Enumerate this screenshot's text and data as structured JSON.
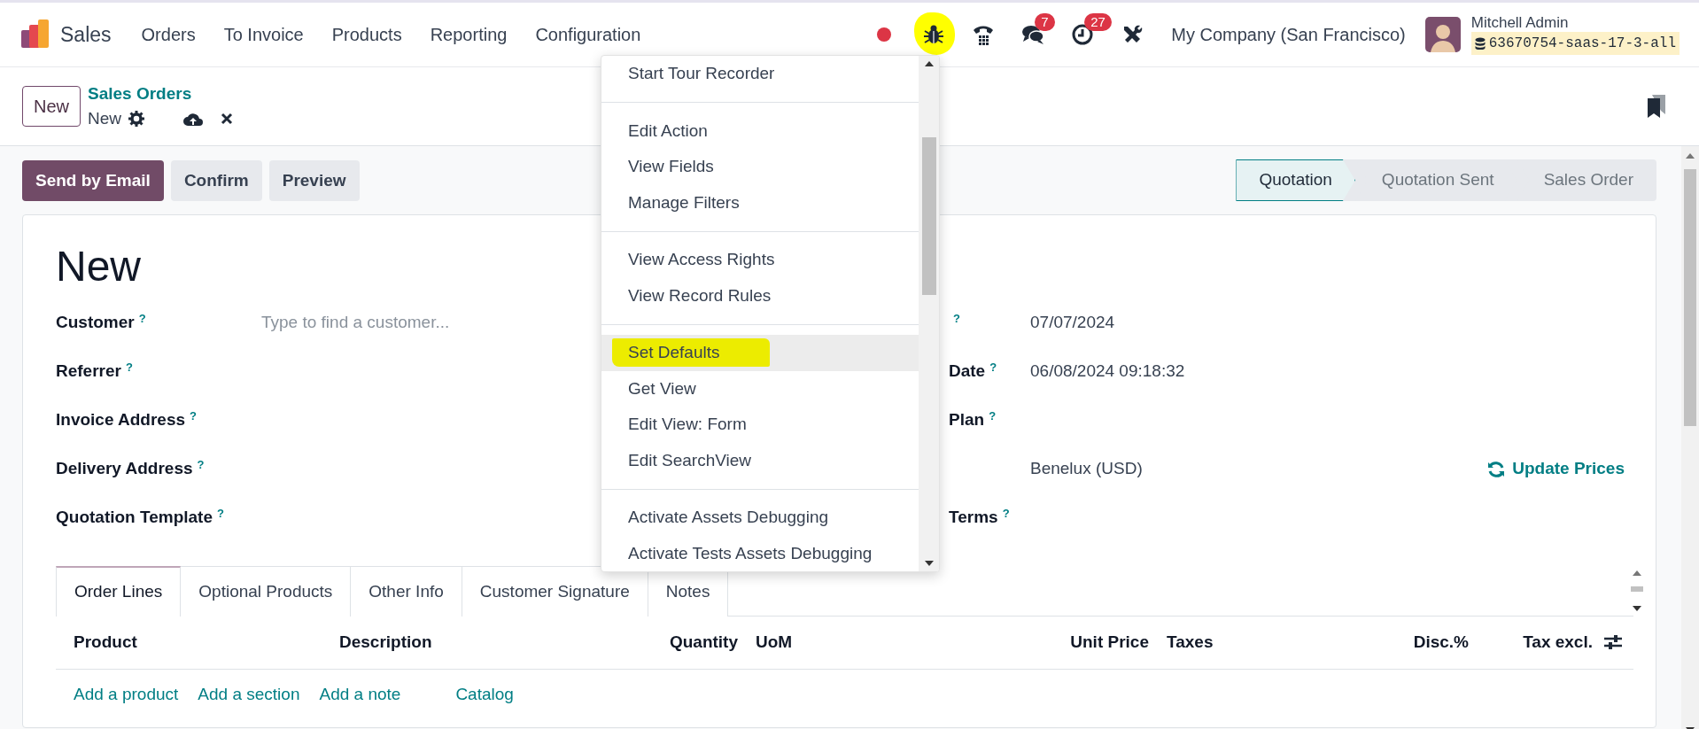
{
  "navbar": {
    "app": "Sales",
    "menus": [
      "Orders",
      "To Invoice",
      "Products",
      "Reporting",
      "Configuration"
    ],
    "systray": [
      {
        "kind": "record",
        "color": "#dc3545"
      },
      {
        "kind": "debug",
        "highlighted": true
      },
      {
        "kind": "phone"
      },
      {
        "kind": "chat",
        "badge": "7"
      },
      {
        "kind": "activity",
        "badge": "27"
      },
      {
        "kind": "tools"
      }
    ],
    "company": "My Company (San Francisco)",
    "user": {
      "name": "Mitchell Admin",
      "database": "63670754-saas-17-3-all"
    }
  },
  "control_panel": {
    "new_button": "New",
    "breadcrumb": "Sales Orders",
    "record": "New"
  },
  "action_buttons": [
    {
      "label": "Send by Email",
      "primary": true
    },
    {
      "label": "Confirm",
      "primary": false
    },
    {
      "label": "Preview",
      "primary": false
    }
  ],
  "statusbar": [
    {
      "label": "Quotation",
      "selected": true
    },
    {
      "label": "Quotation Sent",
      "selected": false
    },
    {
      "label": "Sales Order",
      "selected": false
    }
  ],
  "form": {
    "title": "New",
    "left_fields": [
      {
        "label": "Customer",
        "help": "?",
        "placeholder": "Type to find a customer..."
      },
      {
        "label": "Referrer",
        "help": "?"
      },
      {
        "label": "Invoice Address",
        "help": "?"
      },
      {
        "label": "Delivery Address",
        "help": "?"
      },
      {
        "label": "Quotation Template",
        "help": "?"
      }
    ],
    "right_fields": [
      {
        "help": "?",
        "value": "07/07/2024"
      },
      {
        "label": "Date",
        "help": "?",
        "value": "06/08/2024 09:18:32"
      },
      {
        "label": "Plan",
        "help": "?"
      },
      {
        "value": "Benelux (USD)",
        "action": "Update Prices"
      },
      {
        "label": "Terms",
        "help": "?"
      }
    ]
  },
  "tabs": [
    {
      "label": "Order Lines",
      "selected": true
    },
    {
      "label": "Optional Products",
      "selected": false
    },
    {
      "label": "Other Info",
      "selected": false
    },
    {
      "label": "Customer Signature",
      "selected": false
    },
    {
      "label": "Notes",
      "selected": false
    }
  ],
  "table": {
    "columns": [
      {
        "label": "Product",
        "numeric": false
      },
      {
        "label": "Description",
        "numeric": false
      },
      {
        "label": "Quantity",
        "numeric": true
      },
      {
        "label": "UoM",
        "numeric": false
      },
      {
        "label": "Unit Price",
        "numeric": true
      },
      {
        "label": "Taxes",
        "numeric": false
      },
      {
        "label": "Disc.%",
        "numeric": true
      },
      {
        "label": "Tax excl.",
        "numeric": true
      }
    ],
    "add_links": [
      "Add a product",
      "Add a section",
      "Add a note",
      "Catalog"
    ]
  },
  "debug_menu": {
    "groups": [
      [
        {
          "label": "Start Tour Recorder",
          "hovered": false,
          "highlighted": false
        }
      ],
      [
        {
          "label": "Edit Action",
          "hovered": false,
          "highlighted": false
        },
        {
          "label": "View Fields",
          "hovered": false,
          "highlighted": false
        },
        {
          "label": "Manage Filters",
          "hovered": false,
          "highlighted": false
        }
      ],
      [
        {
          "label": "View Access Rights",
          "hovered": false,
          "highlighted": false
        },
        {
          "label": "View Record Rules",
          "hovered": false,
          "highlighted": false
        }
      ],
      [
        {
          "label": "Set Defaults",
          "hovered": true,
          "highlighted": true
        },
        {
          "label": "Get View",
          "hovered": false,
          "highlighted": false
        },
        {
          "label": "Edit View: Form",
          "hovered": false,
          "highlighted": false
        },
        {
          "label": "Edit SearchView",
          "hovered": false,
          "highlighted": false
        }
      ],
      [
        {
          "label": "Activate Assets Debugging",
          "hovered": false,
          "highlighted": false
        },
        {
          "label": "Activate Tests Assets Debugging",
          "hovered": false,
          "highlighted": false
        }
      ]
    ]
  }
}
